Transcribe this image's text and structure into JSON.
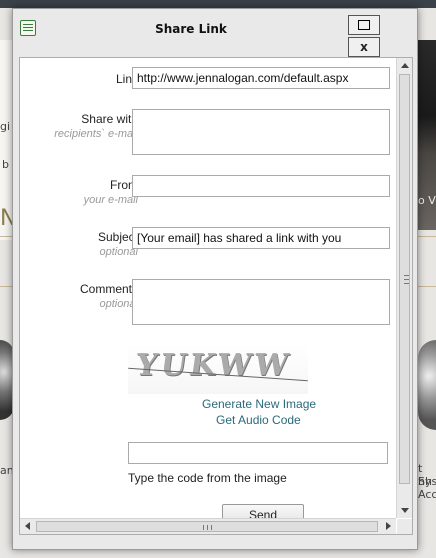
{
  "background": {
    "fragments_left": [
      "gi",
      "b",
      "N",
      "and"
    ],
    "fragments_right": [
      "o V",
      "t Sh",
      "hys",
      "Acc"
    ]
  },
  "dialog": {
    "title": "Share Link",
    "pin_icon": "pin-icon",
    "close_label": "x",
    "form": {
      "link_label": "Link",
      "link_value": "http://www.jennalogan.com/default.aspx",
      "share_with_label": "Share with",
      "share_with_hint": "recipients` e-mail",
      "share_with_value": "",
      "from_label": "From",
      "from_hint": "your e-mail",
      "from_value": "",
      "subject_label": "Subject",
      "subject_hint": "optional",
      "subject_value": "[Your email] has shared a link with you",
      "comments_label": "Comments",
      "comments_hint": "optional",
      "comments_value": ""
    },
    "captcha": {
      "image_text": "YUKWW",
      "generate_label": "Generate New Image",
      "audio_label": "Get Audio Code",
      "code_value": "",
      "instruction": "Type the code from the image"
    },
    "send_label": "Send"
  }
}
